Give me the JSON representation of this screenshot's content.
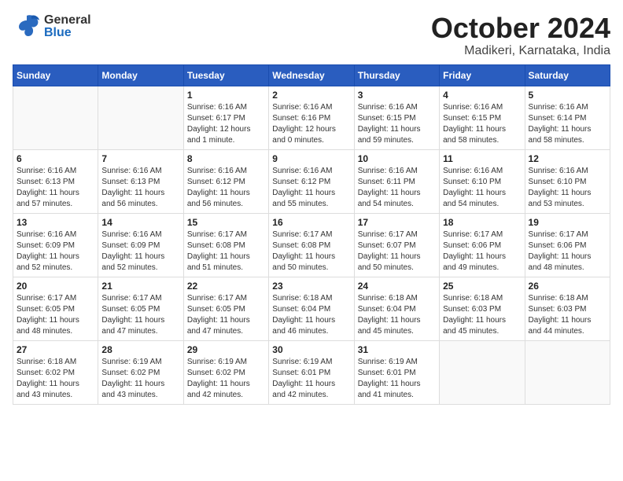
{
  "header": {
    "logo": {
      "general": "General",
      "blue": "Blue",
      "bird_unicode": "🐦"
    },
    "title": "October 2024",
    "location": "Madikeri, Karnataka, India"
  },
  "calendar": {
    "weekdays": [
      "Sunday",
      "Monday",
      "Tuesday",
      "Wednesday",
      "Thursday",
      "Friday",
      "Saturday"
    ],
    "weeks": [
      [
        {
          "day": "",
          "info": ""
        },
        {
          "day": "",
          "info": ""
        },
        {
          "day": "1",
          "info": "Sunrise: 6:16 AM\nSunset: 6:17 PM\nDaylight: 12 hours\nand 1 minute."
        },
        {
          "day": "2",
          "info": "Sunrise: 6:16 AM\nSunset: 6:16 PM\nDaylight: 12 hours\nand 0 minutes."
        },
        {
          "day": "3",
          "info": "Sunrise: 6:16 AM\nSunset: 6:15 PM\nDaylight: 11 hours\nand 59 minutes."
        },
        {
          "day": "4",
          "info": "Sunrise: 6:16 AM\nSunset: 6:15 PM\nDaylight: 11 hours\nand 58 minutes."
        },
        {
          "day": "5",
          "info": "Sunrise: 6:16 AM\nSunset: 6:14 PM\nDaylight: 11 hours\nand 58 minutes."
        }
      ],
      [
        {
          "day": "6",
          "info": "Sunrise: 6:16 AM\nSunset: 6:13 PM\nDaylight: 11 hours\nand 57 minutes."
        },
        {
          "day": "7",
          "info": "Sunrise: 6:16 AM\nSunset: 6:13 PM\nDaylight: 11 hours\nand 56 minutes."
        },
        {
          "day": "8",
          "info": "Sunrise: 6:16 AM\nSunset: 6:12 PM\nDaylight: 11 hours\nand 56 minutes."
        },
        {
          "day": "9",
          "info": "Sunrise: 6:16 AM\nSunset: 6:12 PM\nDaylight: 11 hours\nand 55 minutes."
        },
        {
          "day": "10",
          "info": "Sunrise: 6:16 AM\nSunset: 6:11 PM\nDaylight: 11 hours\nand 54 minutes."
        },
        {
          "day": "11",
          "info": "Sunrise: 6:16 AM\nSunset: 6:10 PM\nDaylight: 11 hours\nand 54 minutes."
        },
        {
          "day": "12",
          "info": "Sunrise: 6:16 AM\nSunset: 6:10 PM\nDaylight: 11 hours\nand 53 minutes."
        }
      ],
      [
        {
          "day": "13",
          "info": "Sunrise: 6:16 AM\nSunset: 6:09 PM\nDaylight: 11 hours\nand 52 minutes."
        },
        {
          "day": "14",
          "info": "Sunrise: 6:16 AM\nSunset: 6:09 PM\nDaylight: 11 hours\nand 52 minutes."
        },
        {
          "day": "15",
          "info": "Sunrise: 6:17 AM\nSunset: 6:08 PM\nDaylight: 11 hours\nand 51 minutes."
        },
        {
          "day": "16",
          "info": "Sunrise: 6:17 AM\nSunset: 6:08 PM\nDaylight: 11 hours\nand 50 minutes."
        },
        {
          "day": "17",
          "info": "Sunrise: 6:17 AM\nSunset: 6:07 PM\nDaylight: 11 hours\nand 50 minutes."
        },
        {
          "day": "18",
          "info": "Sunrise: 6:17 AM\nSunset: 6:06 PM\nDaylight: 11 hours\nand 49 minutes."
        },
        {
          "day": "19",
          "info": "Sunrise: 6:17 AM\nSunset: 6:06 PM\nDaylight: 11 hours\nand 48 minutes."
        }
      ],
      [
        {
          "day": "20",
          "info": "Sunrise: 6:17 AM\nSunset: 6:05 PM\nDaylight: 11 hours\nand 48 minutes."
        },
        {
          "day": "21",
          "info": "Sunrise: 6:17 AM\nSunset: 6:05 PM\nDaylight: 11 hours\nand 47 minutes."
        },
        {
          "day": "22",
          "info": "Sunrise: 6:17 AM\nSunset: 6:05 PM\nDaylight: 11 hours\nand 47 minutes."
        },
        {
          "day": "23",
          "info": "Sunrise: 6:18 AM\nSunset: 6:04 PM\nDaylight: 11 hours\nand 46 minutes."
        },
        {
          "day": "24",
          "info": "Sunrise: 6:18 AM\nSunset: 6:04 PM\nDaylight: 11 hours\nand 45 minutes."
        },
        {
          "day": "25",
          "info": "Sunrise: 6:18 AM\nSunset: 6:03 PM\nDaylight: 11 hours\nand 45 minutes."
        },
        {
          "day": "26",
          "info": "Sunrise: 6:18 AM\nSunset: 6:03 PM\nDaylight: 11 hours\nand 44 minutes."
        }
      ],
      [
        {
          "day": "27",
          "info": "Sunrise: 6:18 AM\nSunset: 6:02 PM\nDaylight: 11 hours\nand 43 minutes."
        },
        {
          "day": "28",
          "info": "Sunrise: 6:19 AM\nSunset: 6:02 PM\nDaylight: 11 hours\nand 43 minutes."
        },
        {
          "day": "29",
          "info": "Sunrise: 6:19 AM\nSunset: 6:02 PM\nDaylight: 11 hours\nand 42 minutes."
        },
        {
          "day": "30",
          "info": "Sunrise: 6:19 AM\nSunset: 6:01 PM\nDaylight: 11 hours\nand 42 minutes."
        },
        {
          "day": "31",
          "info": "Sunrise: 6:19 AM\nSunset: 6:01 PM\nDaylight: 11 hours\nand 41 minutes."
        },
        {
          "day": "",
          "info": ""
        },
        {
          "day": "",
          "info": ""
        }
      ]
    ]
  }
}
